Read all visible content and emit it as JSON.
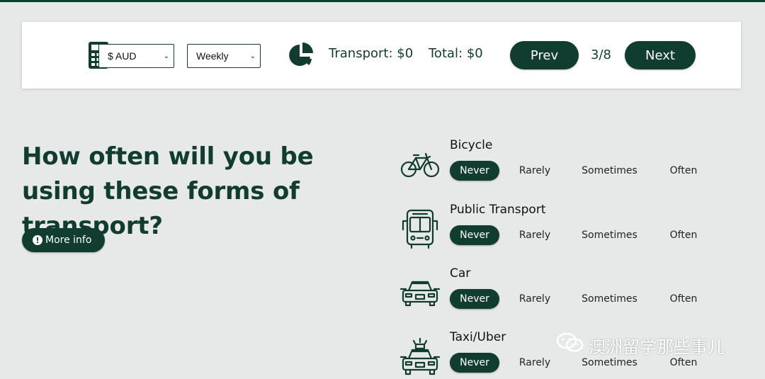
{
  "toolbar": {
    "currency": {
      "value": "$ AUD",
      "options": [
        "$ AUD"
      ]
    },
    "period": {
      "value": "Weekly",
      "options": [
        "Weekly"
      ]
    },
    "transport_summary": "Transport: $0",
    "total_summary": "Total: $0",
    "prev_label": "Prev",
    "page_indicator": "3/8",
    "next_label": "Next",
    "icons": [
      "calculator-icon",
      "pie-chart-icon"
    ]
  },
  "main": {
    "heading": "How often will you be using these forms of transport?",
    "more_info_label": "More info",
    "info_icon_glyph": "!"
  },
  "transport": {
    "options": [
      "Never",
      "Rarely",
      "Sometimes",
      "Often"
    ],
    "items": [
      {
        "label": "Bicycle",
        "icon": "bicycle-icon",
        "selected": "Never"
      },
      {
        "label": "Public Transport",
        "icon": "bus-icon",
        "selected": "Never"
      },
      {
        "label": "Car",
        "icon": "car-icon",
        "selected": "Never"
      },
      {
        "label": "Taxi/Uber",
        "icon": "taxi-icon",
        "selected": "Never"
      }
    ]
  },
  "watermark": {
    "text": "澳洲留学那些事儿",
    "icon": "wechat-icon"
  },
  "colors": {
    "accent": "#113c30",
    "background": "#e6e9e7",
    "panel": "#ffffff"
  }
}
